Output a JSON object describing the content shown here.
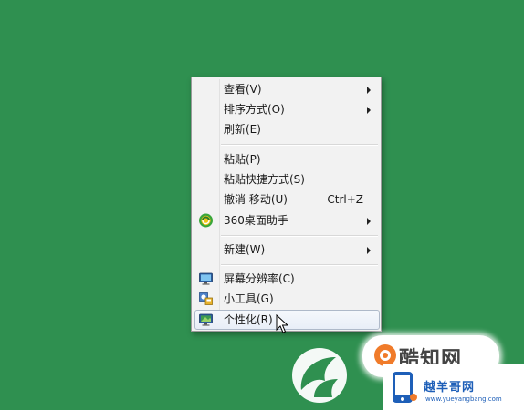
{
  "context_menu": {
    "items": [
      {
        "label": "查看(V)",
        "submenu": true
      },
      {
        "label": "排序方式(O)",
        "submenu": true
      },
      {
        "label": "刷新(E)"
      },
      {
        "label": "粘贴(P)"
      },
      {
        "label": "粘贴快捷方式(S)"
      },
      {
        "label": "撤消 移动(U)",
        "shortcut": "Ctrl+Z"
      },
      {
        "label": "360桌面助手",
        "submenu": true,
        "icon": "360-assistant-icon"
      },
      {
        "label": "新建(W)",
        "submenu": true
      },
      {
        "label": "屏幕分辨率(C)",
        "icon": "monitor-icon"
      },
      {
        "label": "小工具(G)",
        "icon": "gadgets-icon"
      },
      {
        "label": "个性化(R)",
        "icon": "personalize-icon",
        "highlighted": true
      }
    ]
  },
  "watermark": {
    "brand_text": "酷知网",
    "site_name": "越羊哥网",
    "site_url": "www.yueyangbang.com"
  },
  "colors": {
    "desktop_background": "#2f9050",
    "menu_background": "#f2f2f2",
    "highlight_border": "#aeb9c9",
    "brand_blue": "#1e5fb8"
  }
}
